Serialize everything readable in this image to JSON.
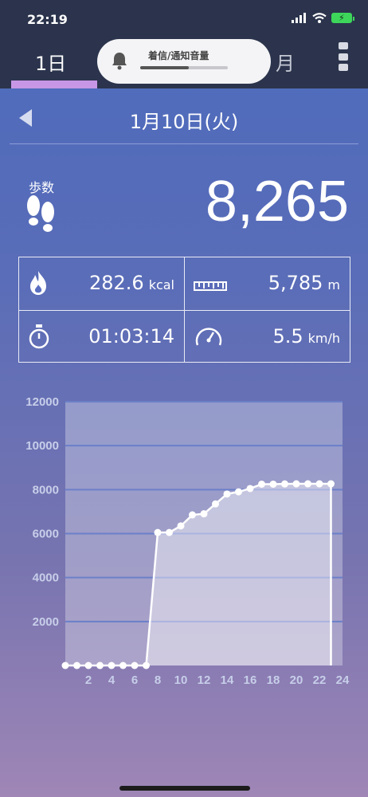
{
  "status_bar": {
    "time": "22:19"
  },
  "tabs": {
    "day": "1日",
    "month": "月"
  },
  "volume_hud": {
    "label": "着信/通知音量",
    "level": 0.55
  },
  "date": {
    "label": "1月10日(火)"
  },
  "steps": {
    "label": "歩数",
    "value": "8,265"
  },
  "stats": {
    "calories": {
      "value": "282.6",
      "unit": "kcal"
    },
    "distance": {
      "value": "5,785",
      "unit": "m"
    },
    "duration": {
      "value": "01:03:14",
      "unit": ""
    },
    "speed": {
      "value": "5.5",
      "unit": "km/h"
    }
  },
  "chart_data": {
    "type": "area",
    "x": [
      0,
      1,
      2,
      3,
      4,
      5,
      6,
      7,
      8,
      9,
      10,
      11,
      12,
      13,
      14,
      15,
      16,
      17,
      18,
      19,
      20,
      21,
      22,
      23
    ],
    "values": [
      0,
      0,
      0,
      0,
      0,
      0,
      0,
      0,
      6050,
      6050,
      6350,
      6850,
      6900,
      7350,
      7800,
      7900,
      8050,
      8250,
      8250,
      8260,
      8265,
      8265,
      8265,
      8265
    ],
    "x_ticks": [
      "2",
      "4",
      "6",
      "8",
      "10",
      "12",
      "14",
      "16",
      "18",
      "20",
      "22",
      "24"
    ],
    "y_ticks": [
      "2000",
      "4000",
      "6000",
      "8000",
      "10000",
      "12000"
    ],
    "xlim": [
      0,
      24
    ],
    "ylim": [
      0,
      12000
    ],
    "grid": true,
    "colors": {
      "line": "#ffffff",
      "grid": "#6b7fc9",
      "area": "rgba(255,255,255,0.42)",
      "plot_bg": "rgba(255,255,255,0.30)"
    }
  }
}
